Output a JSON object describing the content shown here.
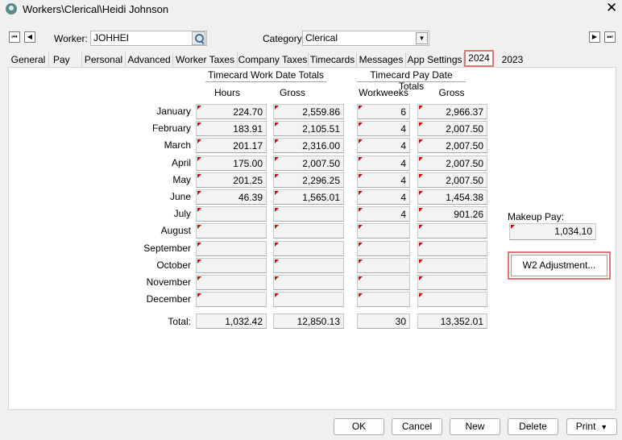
{
  "window": {
    "title": "Workers\\Clerical\\Heidi Johnson",
    "close_label": "✕"
  },
  "nav": {
    "first_glyph": "⏮",
    "prev_glyph": "◀",
    "next_glyph": "▶",
    "last_glyph": "⏭",
    "worker_label": "Worker:",
    "worker_value": "JOHHEI",
    "category_label": "Category:",
    "category_value": "Clerical"
  },
  "tabs": [
    "General",
    "Pay",
    "Personal",
    "Advanced",
    "Worker Taxes",
    "Company Taxes",
    "Timecards",
    "Messages",
    "App Settings",
    "2024",
    "2023"
  ],
  "active_tab": "2024",
  "grid": {
    "group1_title": "Timecard Work Date Totals",
    "group2_title": "Timecard Pay Date Totals",
    "col_hours": "Hours",
    "col_gross1": "Gross",
    "col_workweeks": "Workweeks",
    "col_gross2": "Gross",
    "rows": [
      {
        "month": "January",
        "hours": "224.70",
        "gross1": "2,559.86",
        "workweeks": "6",
        "gross2": "2,966.37"
      },
      {
        "month": "February",
        "hours": "183.91",
        "gross1": "2,105.51",
        "workweeks": "4",
        "gross2": "2,007.50"
      },
      {
        "month": "March",
        "hours": "201.17",
        "gross1": "2,316.00",
        "workweeks": "4",
        "gross2": "2,007.50"
      },
      {
        "month": "April",
        "hours": "175.00",
        "gross1": "2,007.50",
        "workweeks": "4",
        "gross2": "2,007.50"
      },
      {
        "month": "May",
        "hours": "201.25",
        "gross1": "2,296.25",
        "workweeks": "4",
        "gross2": "2,007.50"
      },
      {
        "month": "June",
        "hours": "46.39",
        "gross1": "1,565.01",
        "workweeks": "4",
        "gross2": "1,454.38"
      },
      {
        "month": "July",
        "hours": "",
        "gross1": "",
        "workweeks": "4",
        "gross2": "901.26"
      },
      {
        "month": "August",
        "hours": "",
        "gross1": "",
        "workweeks": "",
        "gross2": ""
      },
      {
        "month": "September",
        "hours": "",
        "gross1": "",
        "workweeks": "",
        "gross2": ""
      },
      {
        "month": "October",
        "hours": "",
        "gross1": "",
        "workweeks": "",
        "gross2": ""
      },
      {
        "month": "November",
        "hours": "",
        "gross1": "",
        "workweeks": "",
        "gross2": ""
      },
      {
        "month": "December",
        "hours": "",
        "gross1": "",
        "workweeks": "",
        "gross2": ""
      }
    ],
    "total_label": "Total:",
    "total": {
      "hours": "1,032.42",
      "gross1": "12,850.13",
      "workweeks": "30",
      "gross2": "13,352.01"
    }
  },
  "makeup": {
    "label": "Makeup Pay:",
    "value": "1,034.10"
  },
  "w2_button": "W2 Adjustment...",
  "footer": {
    "ok": "OK",
    "cancel": "Cancel",
    "new": "New",
    "delete": "Delete",
    "print": "Print"
  },
  "colors": {
    "highlight": "#e27378",
    "flag": "#e00000"
  },
  "icons": {
    "search": "magnifier-icon",
    "dropdown": "chevron-down-icon"
  }
}
